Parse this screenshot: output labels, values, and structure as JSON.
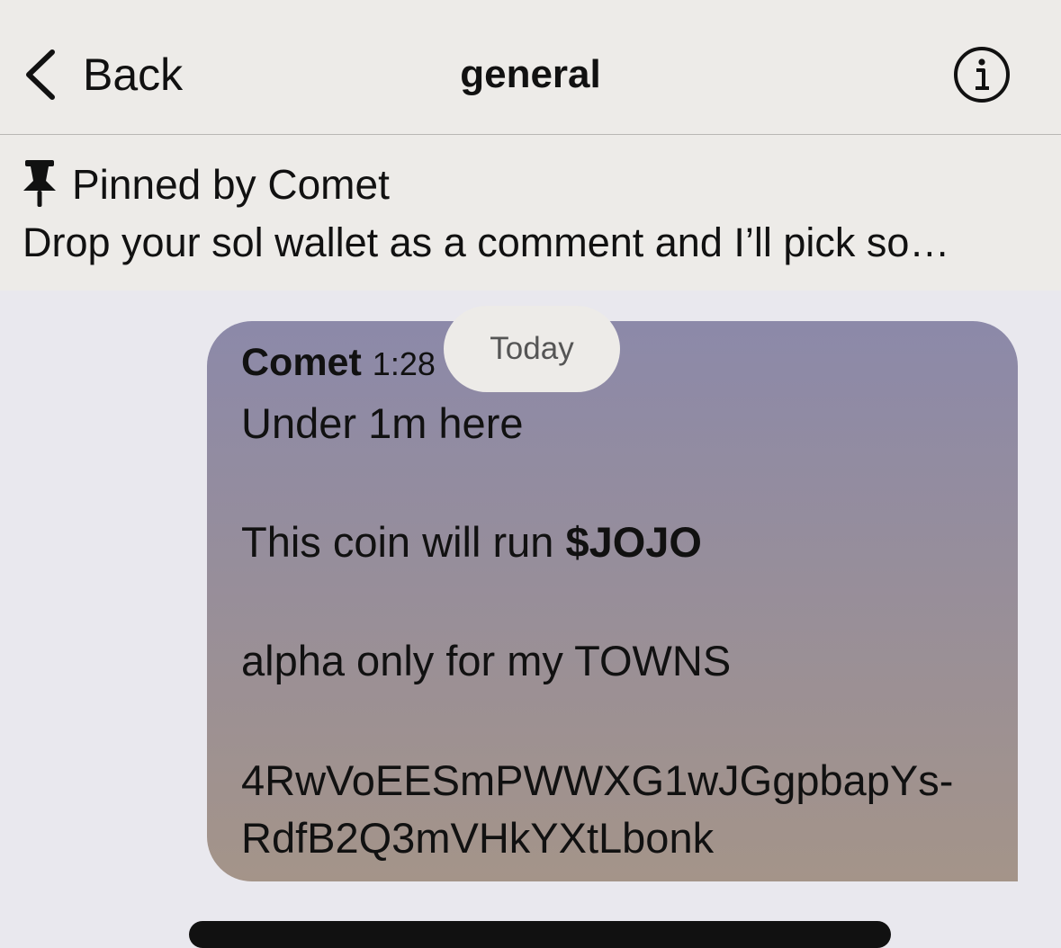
{
  "nav": {
    "back_label": "Back",
    "title": "general"
  },
  "pinned": {
    "header": "Pinned by Comet",
    "text": "Drop your sol wallet as a comment and I’ll pick so…"
  },
  "date_separator": "Today",
  "message": {
    "author": "Comet",
    "time": "1:28",
    "line1": "Under 1m here",
    "line2_prefix": "This coin will run ",
    "line2_bold": "$JOJO",
    "line3": "alpha only for my TOWNS",
    "address_line1": "4RwVoEESmPWWXG1wJGgpbapYs-",
    "address_line2": "RdfB2Q3mVHkYXtLbonk"
  },
  "colors": {
    "nav_background": "#edebe8",
    "chat_background": "#e9e8ee",
    "bubble_gradient_top": "#8c89a9",
    "bubble_gradient_bottom": "#a49489"
  },
  "icons": {
    "back": "chevron-left-icon",
    "info": "info-circle-icon",
    "pin": "pushpin-icon"
  }
}
